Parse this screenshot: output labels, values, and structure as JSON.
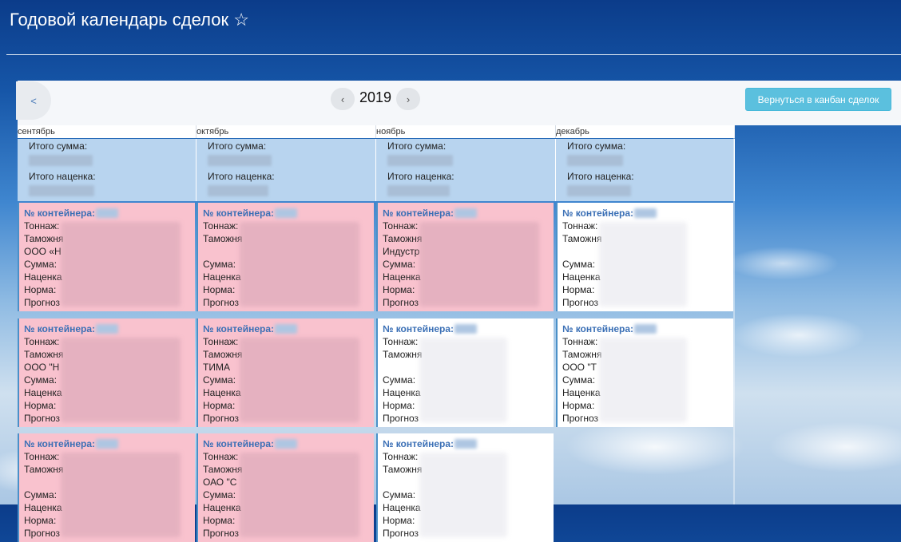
{
  "header": {
    "title": "Годовой календарь сделок",
    "star_icon": "☆"
  },
  "toolbar": {
    "back_label": "<",
    "prev_label": "‹",
    "next_label": "›",
    "year": "2019",
    "kanban_button": "Вернуться в канбан сделок"
  },
  "months": [
    {
      "name": "сентябрь",
      "total_label": "Итого сумма:",
      "markup_label": "Итого наценка:"
    },
    {
      "name": "октябрь",
      "total_label": "Итого сумма:",
      "markup_label": "Итого наценка:"
    },
    {
      "name": "ноябрь",
      "total_label": "Итого сумма:",
      "markup_label": "Итого наценка:"
    },
    {
      "name": "декабрь",
      "total_label": "Итого сумма:",
      "markup_label": "Итого наценка:"
    }
  ],
  "card_labels": {
    "container": "№ контейнера:",
    "tonnage": "Тоннаж:",
    "customs": "Таможня",
    "sum": "Сумма:",
    "markup": "Наценка",
    "norm": "Норма:",
    "forecast": "Прогноз"
  },
  "cards": [
    {
      "color": "pink",
      "line3": "ООО «Н"
    },
    {
      "color": "pink",
      "line3": ""
    },
    {
      "color": "pink",
      "line3": "Индустр"
    },
    {
      "color": "white",
      "line3": ""
    },
    {
      "color": "pink",
      "line3": "ООО \"Н"
    },
    {
      "color": "pink",
      "line3": "ТИМА"
    },
    {
      "color": "white",
      "line3": ""
    },
    {
      "color": "white",
      "line3": "ООО \"Т"
    },
    {
      "color": "pink",
      "line3": ""
    },
    {
      "color": "pink",
      "line3": "ОАО \"С"
    },
    {
      "color": "white",
      "line3": ""
    }
  ],
  "colors": {
    "pink": "#f9c2ce",
    "totals": "#b8d4ef",
    "accent": "#3a6fb5",
    "button": "#5bc0de"
  }
}
